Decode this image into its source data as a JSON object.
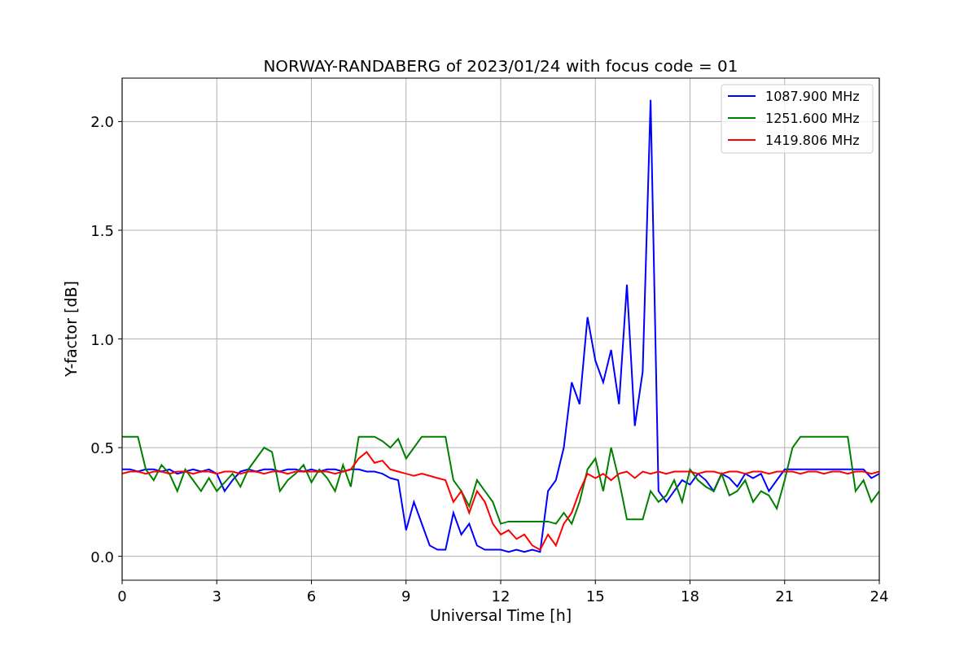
{
  "chart_data": {
    "type": "line",
    "grid": true,
    "legend": true,
    "title": "NORWAY-RANDABERG of 2023/01/24 with focus code = 01",
    "xlabel": "Universal Time [h]",
    "ylabel": "Y-factor [dB]",
    "xlim": [
      0,
      24
    ],
    "ylim": [
      -0.11,
      2.2
    ],
    "xticks": [
      0,
      3,
      6,
      9,
      12,
      15,
      18,
      21,
      24
    ],
    "yticks": [
      {
        "value": 0,
        "label": "0.0"
      },
      {
        "value": 0.5,
        "label": "0.5"
      },
      {
        "value": 1,
        "label": "1.0"
      },
      {
        "value": 1.5,
        "label": "1.5"
      },
      {
        "value": 2,
        "label": "2.0"
      }
    ],
    "x": [
      0,
      0.25,
      0.5,
      0.75,
      1,
      1.25,
      1.5,
      1.75,
      2,
      2.25,
      2.5,
      2.75,
      3,
      3.25,
      3.5,
      3.75,
      4,
      4.25,
      4.5,
      4.75,
      5,
      5.25,
      5.5,
      5.75,
      6,
      6.25,
      6.5,
      6.75,
      7,
      7.25,
      7.5,
      7.75,
      8,
      8.25,
      8.5,
      8.75,
      9,
      9.25,
      9.5,
      9.75,
      10,
      10.25,
      10.5,
      10.75,
      11,
      11.25,
      11.5,
      11.75,
      12,
      12.25,
      12.5,
      12.75,
      13,
      13.25,
      13.5,
      13.75,
      14,
      14.25,
      14.5,
      14.75,
      15,
      15.25,
      15.5,
      15.75,
      16,
      16.25,
      16.5,
      16.75,
      17,
      17.25,
      17.5,
      17.75,
      18,
      18.25,
      18.5,
      18.75,
      19,
      19.25,
      19.5,
      19.75,
      20,
      20.25,
      20.5,
      20.75,
      21,
      21.25,
      21.5,
      21.75,
      22,
      22.25,
      22.5,
      22.75,
      23,
      23.25,
      23.5,
      23.75,
      24
    ],
    "series": [
      {
        "name": "1087.900 MHz",
        "color": "#0000ff",
        "values": [
          0.4,
          0.4,
          0.39,
          0.4,
          0.4,
          0.39,
          0.4,
          0.38,
          0.39,
          0.4,
          0.39,
          0.4,
          0.38,
          0.3,
          0.35,
          0.39,
          0.4,
          0.39,
          0.4,
          0.4,
          0.39,
          0.4,
          0.4,
          0.39,
          0.4,
          0.39,
          0.4,
          0.4,
          0.39,
          0.4,
          0.4,
          0.39,
          0.39,
          0.38,
          0.36,
          0.35,
          0.12,
          0.25,
          0.15,
          0.05,
          0.03,
          0.03,
          0.2,
          0.1,
          0.15,
          0.05,
          0.03,
          0.03,
          0.03,
          0.02,
          0.03,
          0.02,
          0.03,
          0.02,
          0.3,
          0.35,
          0.5,
          0.8,
          0.7,
          1.1,
          0.9,
          0.8,
          0.95,
          0.7,
          1.25,
          0.6,
          0.85,
          2.1,
          0.3,
          0.25,
          0.3,
          0.35,
          0.33,
          0.38,
          0.35,
          0.3,
          0.38,
          0.36,
          0.32,
          0.38,
          0.36,
          0.38,
          0.3,
          0.35,
          0.4,
          0.4,
          0.4,
          0.4,
          0.4,
          0.4,
          0.4,
          0.4,
          0.4,
          0.4,
          0.4,
          0.36,
          0.38
        ]
      },
      {
        "name": "1251.600 MHz",
        "color": "#008000",
        "values": [
          0.55,
          0.55,
          0.55,
          0.4,
          0.35,
          0.42,
          0.38,
          0.3,
          0.4,
          0.35,
          0.3,
          0.36,
          0.3,
          0.34,
          0.38,
          0.32,
          0.4,
          0.45,
          0.5,
          0.48,
          0.3,
          0.35,
          0.38,
          0.42,
          0.34,
          0.4,
          0.36,
          0.3,
          0.42,
          0.32,
          0.55,
          0.55,
          0.55,
          0.53,
          0.5,
          0.54,
          0.45,
          0.5,
          0.55,
          0.55,
          0.55,
          0.55,
          0.35,
          0.3,
          0.23,
          0.35,
          0.3,
          0.25,
          0.15,
          0.16,
          0.16,
          0.16,
          0.16,
          0.16,
          0.16,
          0.15,
          0.2,
          0.15,
          0.25,
          0.4,
          0.45,
          0.3,
          0.5,
          0.35,
          0.17,
          0.17,
          0.17,
          0.3,
          0.25,
          0.28,
          0.35,
          0.25,
          0.4,
          0.35,
          0.32,
          0.3,
          0.38,
          0.28,
          0.3,
          0.35,
          0.25,
          0.3,
          0.28,
          0.22,
          0.35,
          0.5,
          0.55,
          0.55,
          0.55,
          0.55,
          0.55,
          0.55,
          0.55,
          0.3,
          0.35,
          0.25,
          0.3
        ]
      },
      {
        "name": "1419.806 MHz",
        "color": "#ff0000",
        "values": [
          0.38,
          0.39,
          0.39,
          0.38,
          0.39,
          0.39,
          0.38,
          0.39,
          0.39,
          0.38,
          0.39,
          0.39,
          0.38,
          0.39,
          0.39,
          0.38,
          0.39,
          0.39,
          0.38,
          0.39,
          0.39,
          0.38,
          0.39,
          0.39,
          0.39,
          0.39,
          0.39,
          0.38,
          0.39,
          0.4,
          0.45,
          0.48,
          0.43,
          0.44,
          0.4,
          0.39,
          0.38,
          0.37,
          0.38,
          0.37,
          0.36,
          0.35,
          0.25,
          0.3,
          0.2,
          0.3,
          0.25,
          0.15,
          0.1,
          0.12,
          0.08,
          0.1,
          0.05,
          0.03,
          0.1,
          0.05,
          0.15,
          0.2,
          0.3,
          0.38,
          0.36,
          0.38,
          0.35,
          0.38,
          0.39,
          0.36,
          0.39,
          0.38,
          0.39,
          0.38,
          0.39,
          0.39,
          0.39,
          0.38,
          0.39,
          0.39,
          0.38,
          0.39,
          0.39,
          0.38,
          0.39,
          0.39,
          0.38,
          0.39,
          0.39,
          0.39,
          0.38,
          0.39,
          0.39,
          0.38,
          0.39,
          0.39,
          0.38,
          0.39,
          0.39,
          0.38,
          0.39
        ]
      }
    ]
  }
}
